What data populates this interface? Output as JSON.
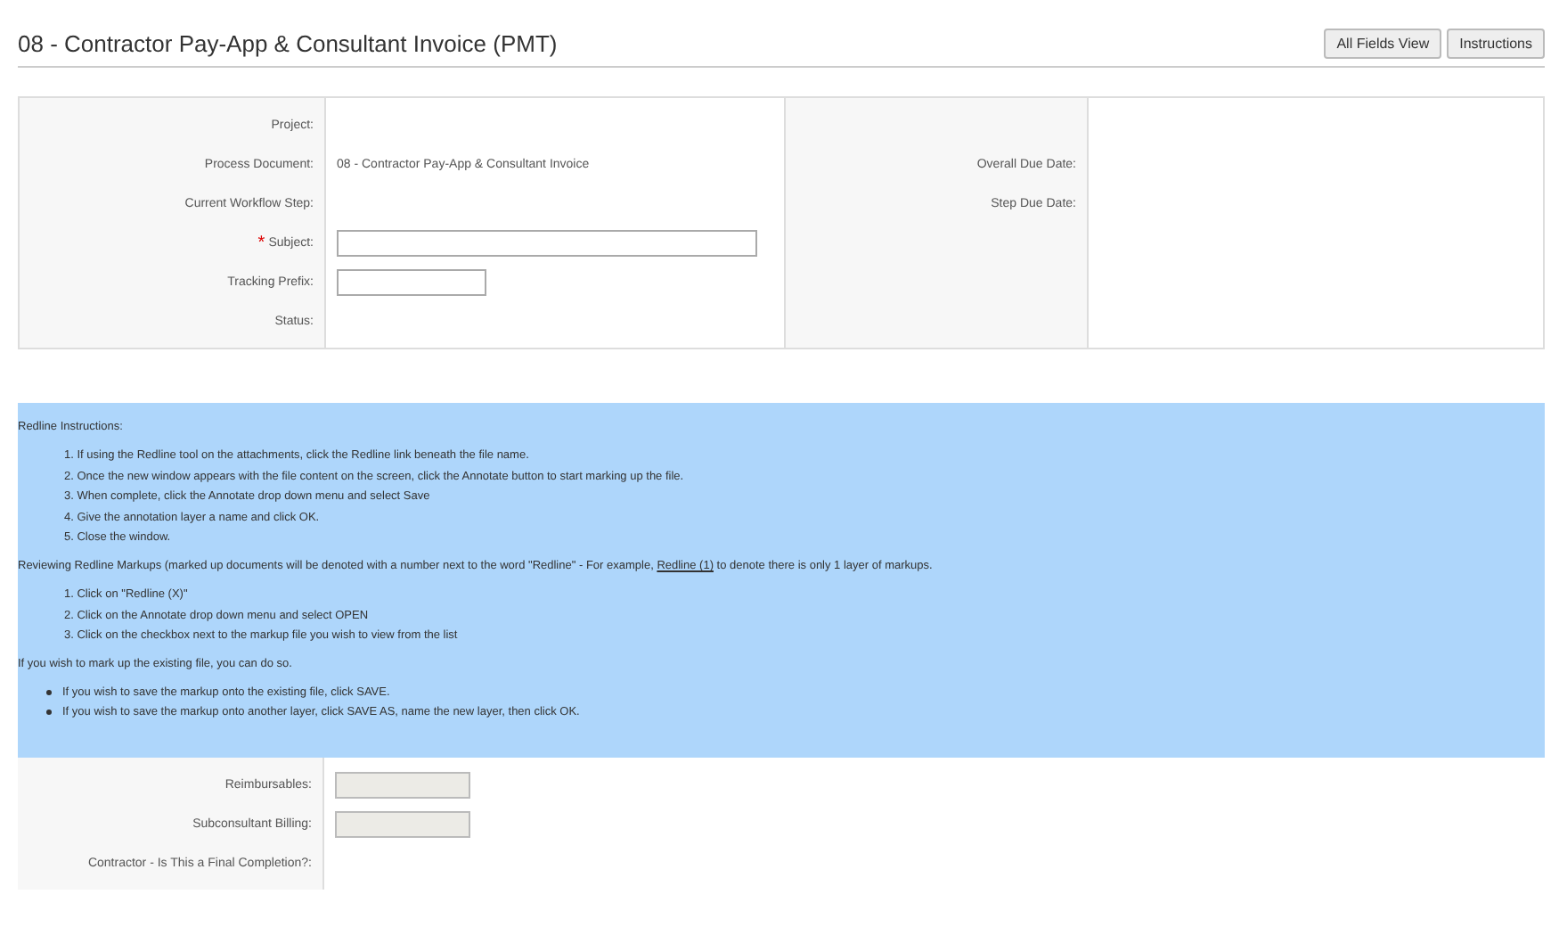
{
  "title": "08 - Contractor Pay-App & Consultant Invoice (PMT)",
  "buttons": [
    "All Fields View",
    "Instructions"
  ],
  "header_fields": [
    {
      "label": "Project:",
      "kind": "text",
      "required": false
    },
    {
      "label": "Process Document:",
      "kind": "text",
      "value": "08 - Contractor Pay-App & Consultant Invoice",
      "required": false
    },
    {
      "label": "Current Workflow Step:",
      "kind": "text",
      "required": false
    },
    {
      "label": "Subject:",
      "kind": "wide-input",
      "required": true,
      "required_mark": "*"
    },
    {
      "label": "Tracking Prefix:",
      "kind": "short-input",
      "required": false
    },
    {
      "label": "Status:",
      "kind": "text",
      "required": false
    }
  ],
  "right_fields": [
    {
      "label": "Overall Due Date:"
    },
    {
      "label": "Step Due Date:"
    }
  ],
  "instructions": {
    "heading": "Redline Instructions:",
    "steps": [
      "1. If using the Redline tool on the attachments, click the Redline link beneath the file name.",
      "2. Once the new window appears with the file content on the screen, click the Annotate button to start marking up the file.",
      "3. When complete, click the Annotate drop down menu and select Save",
      "4. Give the annotation layer a name and click OK.",
      "5. Close the window."
    ],
    "reviewing": {
      "before": "Reviewing Redline Markups (marked up documents will be denoted with a number next to the word \"Redline\" - For example, ",
      "link": "Redline (1)",
      "after": " to denote there is only 1 layer of markups."
    },
    "review_steps": [
      "1. Click on \"Redline (X)\"",
      "2. Click on the Annotate drop down menu and select OPEN",
      "3. Click on the checkbox next to the markup file you wish to view from the list"
    ],
    "markup_note": "If you wish to mark up the existing file, you can do so.",
    "bullets": [
      "If you wish to save the markup onto the existing file, click SAVE.",
      "If you wish to save the markup onto another layer, click SAVE AS, name the new layer, then click OK."
    ]
  },
  "lower_fields": [
    {
      "label": "Reimbursables:",
      "kind": "input"
    },
    {
      "label": "Subconsultant Billing:",
      "kind": "input"
    },
    {
      "label": "Contractor - Is This a Final Completion?:",
      "kind": "text"
    }
  ]
}
